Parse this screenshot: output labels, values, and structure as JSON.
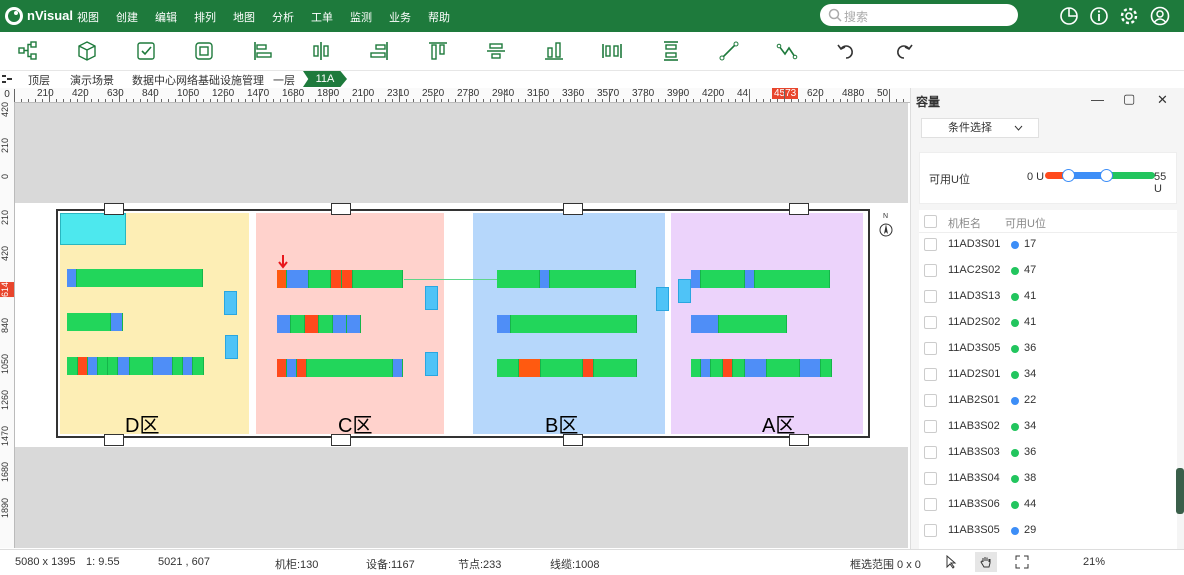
{
  "app": {
    "name": "nVisual"
  },
  "menu": [
    "视图",
    "创建",
    "编辑",
    "排列",
    "地图",
    "分析",
    "工单",
    "监测",
    "业务",
    "帮助"
  ],
  "search": {
    "placeholder": "搜索"
  },
  "breadcrumb": [
    "顶层",
    "演示场景",
    "数据中心网络基础设施管理",
    "一层",
    "11A"
  ],
  "ruler": {
    "top": [
      "0",
      "210",
      "420",
      "630",
      "840",
      "1050",
      "1260",
      "1470",
      "1680",
      "1890",
      "2100",
      "2310",
      "2520",
      "2730",
      "2940",
      "3150",
      "3360",
      "3570",
      "3780",
      "3990",
      "4200",
      "44",
      "4573",
      "620",
      "4830",
      "50"
    ],
    "left": [
      "420",
      "210",
      "0",
      "210",
      "420",
      "614",
      "840",
      "1050",
      "1260",
      "1470",
      "1680",
      "1890"
    ]
  },
  "zones": [
    "D区",
    "C区",
    "B区",
    "A区"
  ],
  "compass": "N",
  "colors": {
    "brand": "#1e7a3c",
    "rack_green": "#22d65b",
    "rack_blue": "#4f8ef7",
    "rack_red": "#ff4a1c",
    "rack_orange": "#ff5a10",
    "zone_d": "#fdeeb5",
    "zone_c": "#ffd2cc",
    "zone_b": "#b6d7fb",
    "zone_a": "#ecd3fb",
    "ac": "#4fc3f7"
  },
  "status": {
    "size": "5080 x 1395",
    "scale": "1: 9.55",
    "coord": "5021 , 607",
    "cabinets": "机柜:130",
    "devices": "设备:1167",
    "nodes": "节点:233",
    "cables": "线缆:1008",
    "selection": "框选范围 0 x 0",
    "zoom": "21%"
  },
  "panel": {
    "title": "容量",
    "filter": "条件选择",
    "available_label": "可用U位",
    "range_min": "0 U",
    "range_max": "55 U",
    "col_name": "机柜名",
    "col_avail": "可用U位",
    "rows": [
      {
        "name": "11AD3S01",
        "value": "17",
        "color": "#3d8ef7"
      },
      {
        "name": "11AC2S02",
        "value": "47",
        "color": "#22c55e"
      },
      {
        "name": "11AD3S13",
        "value": "41",
        "color": "#22c55e"
      },
      {
        "name": "11AD2S02",
        "value": "41",
        "color": "#22c55e"
      },
      {
        "name": "11AD3S05",
        "value": "36",
        "color": "#22c55e"
      },
      {
        "name": "11AD2S01",
        "value": "34",
        "color": "#22c55e"
      },
      {
        "name": "11AB2S01",
        "value": "22",
        "color": "#3d8ef7"
      },
      {
        "name": "11AB3S02",
        "value": "34",
        "color": "#22c55e"
      },
      {
        "name": "11AB3S03",
        "value": "36",
        "color": "#22c55e"
      },
      {
        "name": "11AB3S04",
        "value": "38",
        "color": "#22c55e"
      },
      {
        "name": "11AB3S06",
        "value": "44",
        "color": "#22c55e"
      },
      {
        "name": "11AB3S05",
        "value": "29",
        "color": "#3d8ef7"
      }
    ]
  }
}
